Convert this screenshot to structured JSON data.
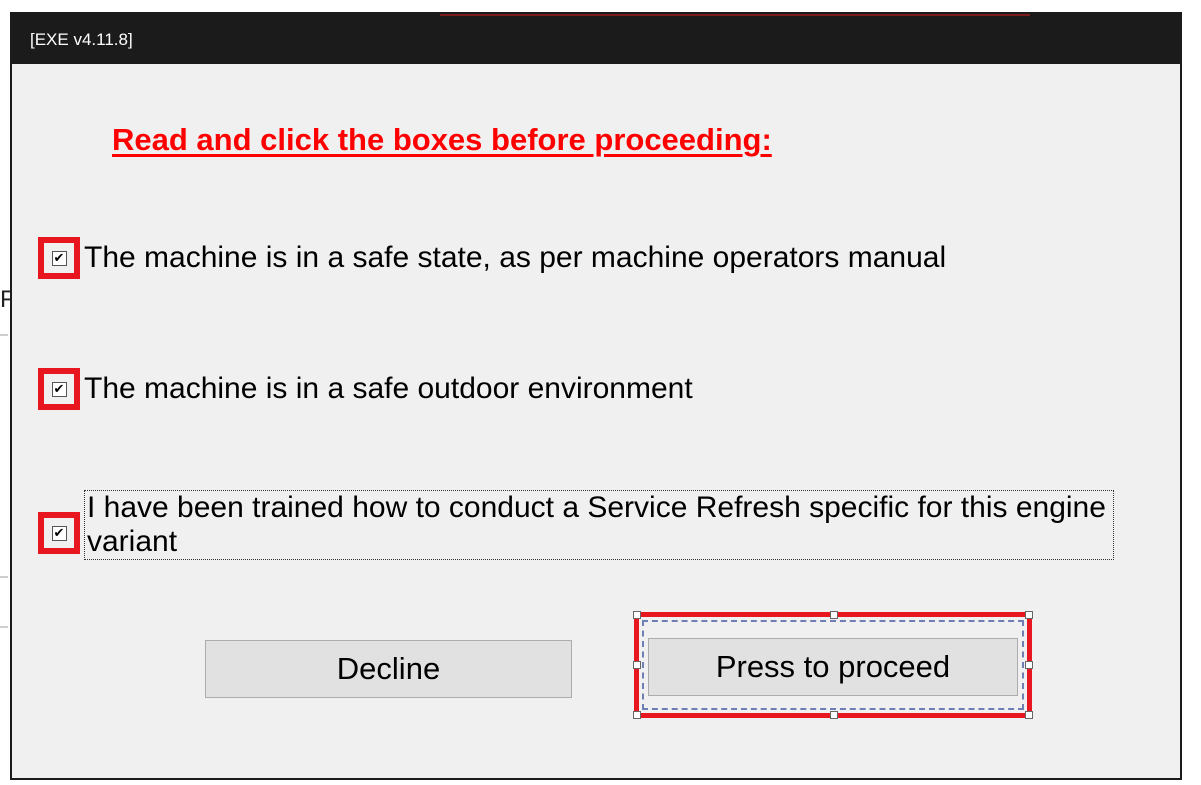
{
  "window": {
    "title": "[EXE v4.11.8]"
  },
  "dialog": {
    "heading": "Read and click the boxes before proceeding:",
    "checks": [
      {
        "label": "The machine is in a safe state, as per machine operators manual",
        "checked": true
      },
      {
        "label": "The machine is in a safe outdoor environment",
        "checked": true
      },
      {
        "label": "I have been trained how to conduct a Service Refresh specific for this engine variant",
        "checked": true
      }
    ],
    "check_mark": "✔",
    "buttons": {
      "decline": "Decline",
      "proceed": "Press to proceed"
    }
  },
  "colors": {
    "heading": "#ff0000",
    "highlight": "#e8161e",
    "titlebar": "#1b1b1b",
    "dialog_bg": "#f0f0f0"
  },
  "background": {
    "fragment": "F"
  }
}
